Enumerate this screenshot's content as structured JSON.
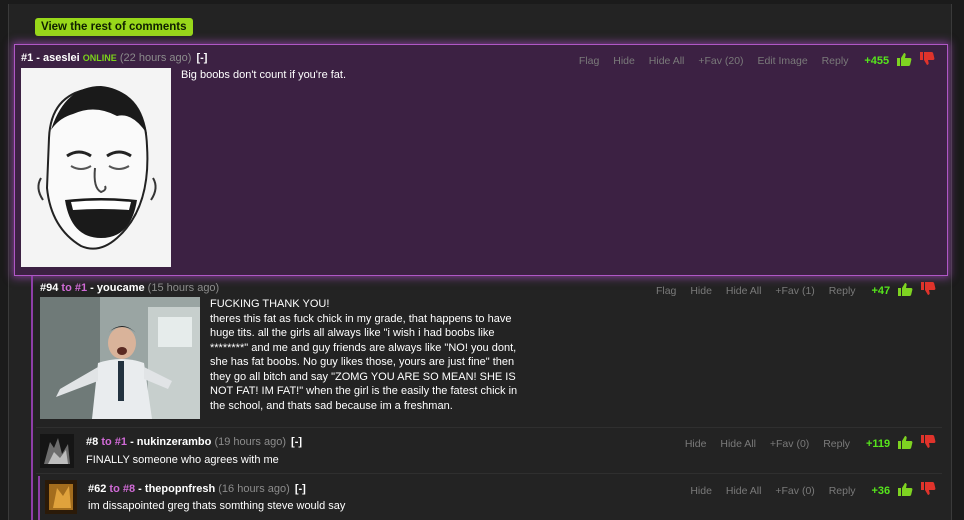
{
  "view_rest_label": "View the rest of comments",
  "comments": [
    {
      "num": "#1",
      "user": "aseslei",
      "online": "ONLINE",
      "ago": "(22 hours ago)",
      "toggle": "[-]",
      "actions": [
        "Flag",
        "Hide",
        "Hide All",
        "+Fav (20)",
        "Edit Image",
        "Reply"
      ],
      "score": "+455",
      "text": "Big boobs don't count if you're fat."
    },
    {
      "num": "#94",
      "to_word": "to",
      "to_num": "#1",
      "user": "youcame",
      "ago": "(15 hours ago)",
      "actions": [
        "Flag",
        "Hide",
        "Hide All",
        "+Fav (1)",
        "Reply"
      ],
      "score": "+47",
      "text": "FUCKING THANK YOU!\ntheres this fat as fuck chick in my grade, that happens to have\nhuge tits. all the girls all always like \"i wish i had boobs like\n********\" and me and guy friends are always like \"NO! you dont,\nshe has fat boobs. No guy likes those, yours are just fine\" then\nthey go all bitch and say \"ZOMG YOU ARE SO MEAN! SHE IS\nNOT FAT! IM FAT!\" when the girl is the easily the fatest chick in\nthe school, and thats sad because im a freshman."
    },
    {
      "num": "#8",
      "to_word": "to",
      "to_num": "#1",
      "user": "nukinzerambo",
      "ago": "(19 hours ago)",
      "toggle": "[-]",
      "actions": [
        "Hide",
        "Hide All",
        "+Fav (0)",
        "Reply"
      ],
      "score": "+119",
      "text": "FINALLY someone who agrees with me"
    },
    {
      "num": "#62",
      "to_word": "to",
      "to_num": "#8",
      "user": "thepopnfresh",
      "ago": "(16 hours ago)",
      "toggle": "[-]",
      "actions": [
        "Hide",
        "Hide All",
        "+Fav (0)",
        "Reply"
      ],
      "score": "+36",
      "text": "im dissapointed greg thats somthing steve would say"
    }
  ],
  "colors": {
    "highlight_bg": "#3c2143",
    "highlight_border": "#b057c6",
    "accent_green": "#98d81a",
    "score_green": "#56e51c",
    "reply_pink": "#d06ad6",
    "thumb_up": "#7ed321",
    "thumb_down": "#e0332b"
  },
  "icons": [
    "thumbs-up-icon",
    "thumbs-down-icon"
  ]
}
